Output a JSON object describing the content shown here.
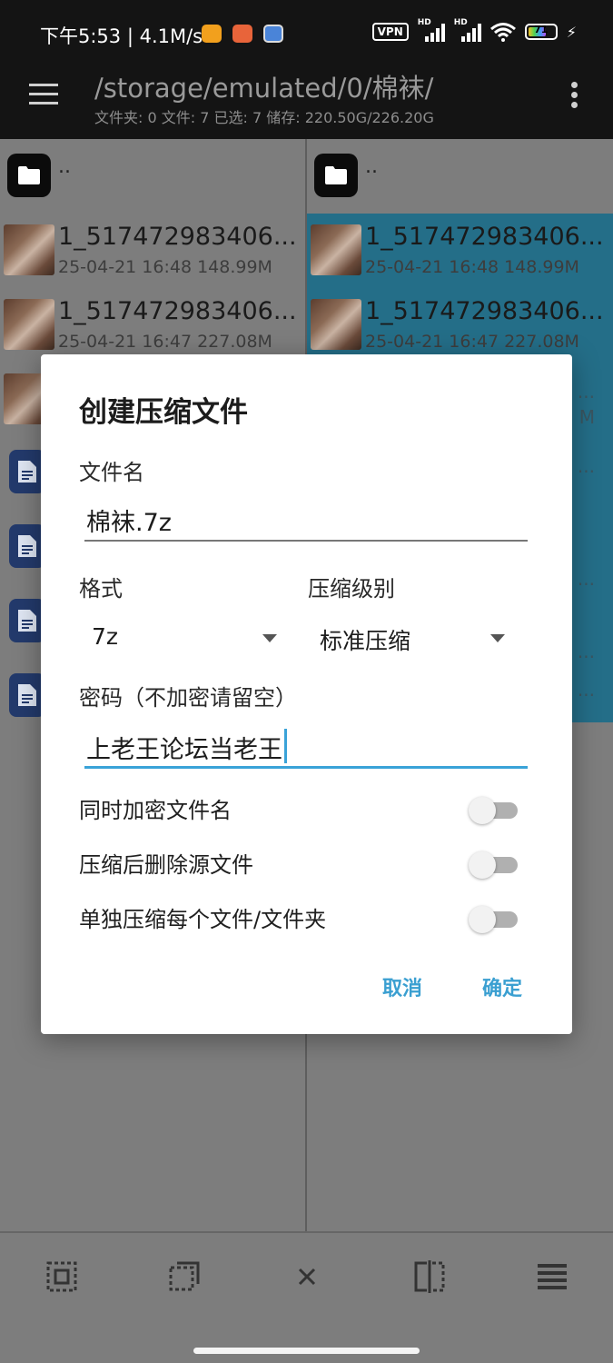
{
  "status_bar": {
    "time": "下午5:53 | 4.1M/s",
    "vpn": "VPN",
    "hd": "HD",
    "battery": "71",
    "accent_battery": "#4fd24f"
  },
  "app_bar": {
    "path": "/storage/emulated/0/棉袜/",
    "stats": "文件夹: 0  文件: 7  已选: 7  储存: 220.50G/226.20G"
  },
  "panes": {
    "up_label": "..",
    "left_files": [
      {
        "name": "1_517472983406...",
        "meta": "25-04-21 16:48  148.99M"
      },
      {
        "name": "1_517472983406...",
        "meta": "25-04-21 16:47  227.08M"
      }
    ],
    "right_files": [
      {
        "name": "1_517472983406...",
        "meta": "25-04-21 16:48  148.99M"
      },
      {
        "name": "1_517472983406...",
        "meta": "25-04-21 16:47  227.08M"
      }
    ],
    "right_trails": [
      "...",
      "M",
      "...",
      "...",
      "...",
      "..."
    ],
    "selection_color": "#246e88"
  },
  "dialog": {
    "title": "创建压缩文件",
    "filename_label": "文件名",
    "filename_value": "棉袜.7z",
    "format_label": "格式",
    "format_value": "7z",
    "level_label": "压缩级别",
    "level_value": "标准压缩",
    "password_label": "密码（不加密请留空）",
    "password_value": "上老王论坛当老王",
    "encrypt_names_label": "同时加密文件名",
    "delete_source_label": "压缩后删除源文件",
    "separate_label": "单独压缩每个文件/文件夹",
    "cancel_label": "取消",
    "ok_label": "确定",
    "accent_color": "#3aa3d8"
  }
}
